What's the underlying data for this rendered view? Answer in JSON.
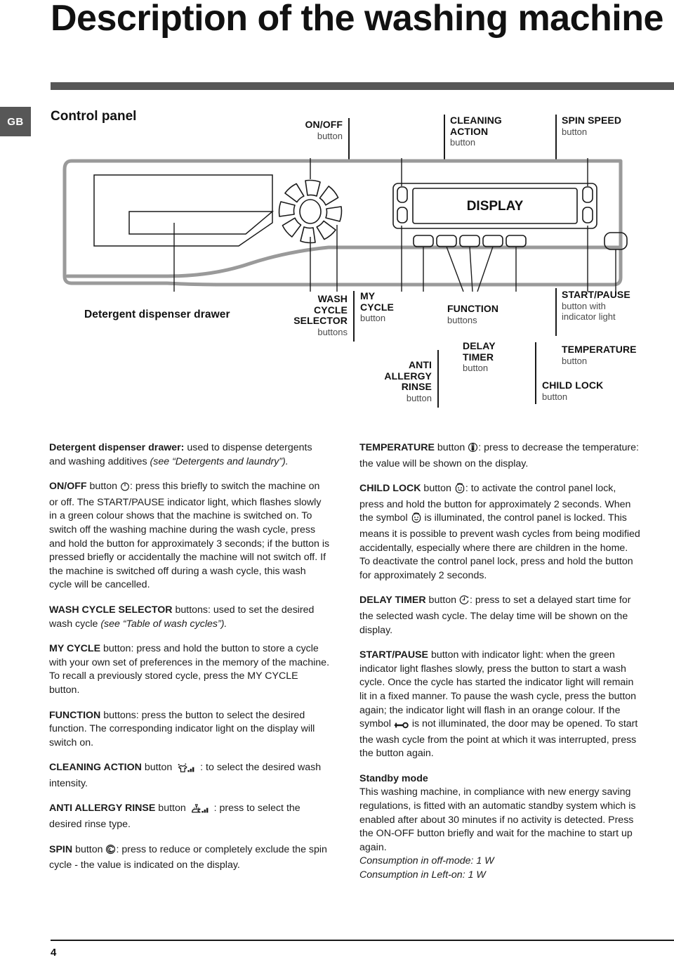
{
  "header": {
    "title": "Description of the washing machine",
    "locale_badge": "GB",
    "section_title": "Control panel"
  },
  "diagram": {
    "display_label": "DISPLAY",
    "drawer_label": "Detergent dispenser drawer",
    "callouts": {
      "on_off": {
        "name": "ON/OFF",
        "sub": "button"
      },
      "cleaning_action": {
        "name_line1": "CLEANING",
        "name_line2": "ACTION",
        "sub": "button"
      },
      "spin_speed": {
        "name": "SPIN SPEED",
        "sub": "button"
      },
      "wash_cycle_selector": {
        "name_line1": "WASH",
        "name_line2": "CYCLE",
        "name_line3": "SELECTOR",
        "sub": "buttons"
      },
      "my_cycle": {
        "name_line1": "MY",
        "name_line2": "CYCLE",
        "sub": "button"
      },
      "anti_allergy_rinse": {
        "name_line1": "ANTI",
        "name_line2": "ALLERGY",
        "name_line3": "RINSE",
        "sub": "button"
      },
      "function": {
        "name": "FUNCTION",
        "sub": "buttons"
      },
      "delay_timer": {
        "name_line1": "DELAY",
        "name_line2": "TIMER",
        "sub": "button"
      },
      "start_pause": {
        "name": "START/PAUSE",
        "sub_line1": "button with",
        "sub_line2": "indicator light"
      },
      "temperature": {
        "name": "TEMPERATURE",
        "sub": "button"
      },
      "child_lock": {
        "name": "CHILD LOCK",
        "sub": "button"
      }
    }
  },
  "body": {
    "left": {
      "detergent_drawer": {
        "term": "Detergent dispenser drawer:",
        "text": " used to dispense detergents and washing additives ",
        "italic": "(see “Detergents and laundry”)."
      },
      "on_off": {
        "term": "ON/OFF",
        "pre": " button ",
        "icon": "power-icon",
        "text": ": press this briefly to switch the machine on or off. The START/PAUSE indicator light, which flashes slowly in a green colour shows that the machine is switched on. To switch off the washing machine during the wash cycle, press and hold the button for approximately 3 seconds; if the button is pressed briefly or accidentally the machine will not switch off. If the machine is switched off during a wash cycle, this wash cycle will be cancelled."
      },
      "wash_cycle_selector": {
        "term": "WASH CYCLE SELECTOR",
        "text": " buttons: used to set the desired wash cycle ",
        "italic": "(see “Table of wash cycles”)."
      },
      "my_cycle": {
        "term": "MY CYCLE",
        "text": " button: press and hold the button to store a cycle with your own set of preferences in the memory of the machine. To recall a previously stored cycle, press the MY CYCLE button."
      },
      "function": {
        "term": "FUNCTION",
        "text": " buttons: press the button to select the desired function. The corresponding indicator light on the display will switch on."
      },
      "cleaning_action": {
        "term": "CLEANING ACTION",
        "pre": " button ",
        "icon": "tshirt-sparkle-bars-icon",
        "text": " : to select the desired wash intensity."
      },
      "anti_allergy_rinse": {
        "term": "ANTI ALLERGY RINSE",
        "pre": " button ",
        "icon": "rinse-shower-bars-icon",
        "text": " : press to select the desired rinse type."
      },
      "spin": {
        "term": "SPIN",
        "pre": " button ",
        "icon": "spin-spiral-icon",
        "text": ": press to reduce or completely exclude the spin cycle - the value is indicated on the display."
      }
    },
    "right": {
      "temperature": {
        "term": "TEMPERATURE",
        "pre": " button ",
        "icon": "thermometer-icon",
        "text": ": press to decrease the temperature: the value will be shown on the display."
      },
      "child_lock": {
        "term": "CHILD LOCK",
        "pre": " button ",
        "icon": "child-face-icon",
        "text1": ": to activate the control panel lock, press and hold the button for approximately 2 seconds. When the symbol ",
        "icon2": "child-face-icon",
        "text2": " is illuminated, the control panel is locked. This means it is possible to prevent wash cycles from being modified accidentally, especially where there are children in the home. To deactivate the control panel lock, press and hold the button for approximately 2 seconds."
      },
      "delay_timer": {
        "term": "DELAY TIMER",
        "pre": " button ",
        "icon": "clock-delay-icon",
        "text": ": press to set a delayed start time for the selected wash cycle. The delay time will be shown on the display."
      },
      "start_pause": {
        "term": "START/PAUSE",
        "text1": " button with indicator light: when the green indicator light flashes slowly, press the button to start a wash cycle. Once the cycle has started the indicator light will remain lit in a fixed manner. To pause the wash cycle, press the button again; the indicator light will flash in an orange colour. If the symbol ",
        "icon": "door-lock-key-icon",
        "text2": " is not illuminated, the door may be opened. To start the wash cycle from the point at which it was interrupted, press the button again."
      },
      "standby": {
        "heading": "Standby mode",
        "text": "This washing machine, in compliance with new energy saving regulations, is fitted with an automatic standby system which is enabled after about 30 minutes if no activity is detected. Press the ON-OFF button briefly and wait for the machine to start up again.",
        "italic1": "Consumption in off-mode: 1 W",
        "italic2": "Consumption in Left-on: 1 W"
      }
    }
  },
  "footer": {
    "page_number": "4"
  },
  "colors": {
    "accent_gray": "#575757",
    "ink": "#1a1a1a",
    "panel_outline": "#9a9a9a"
  }
}
